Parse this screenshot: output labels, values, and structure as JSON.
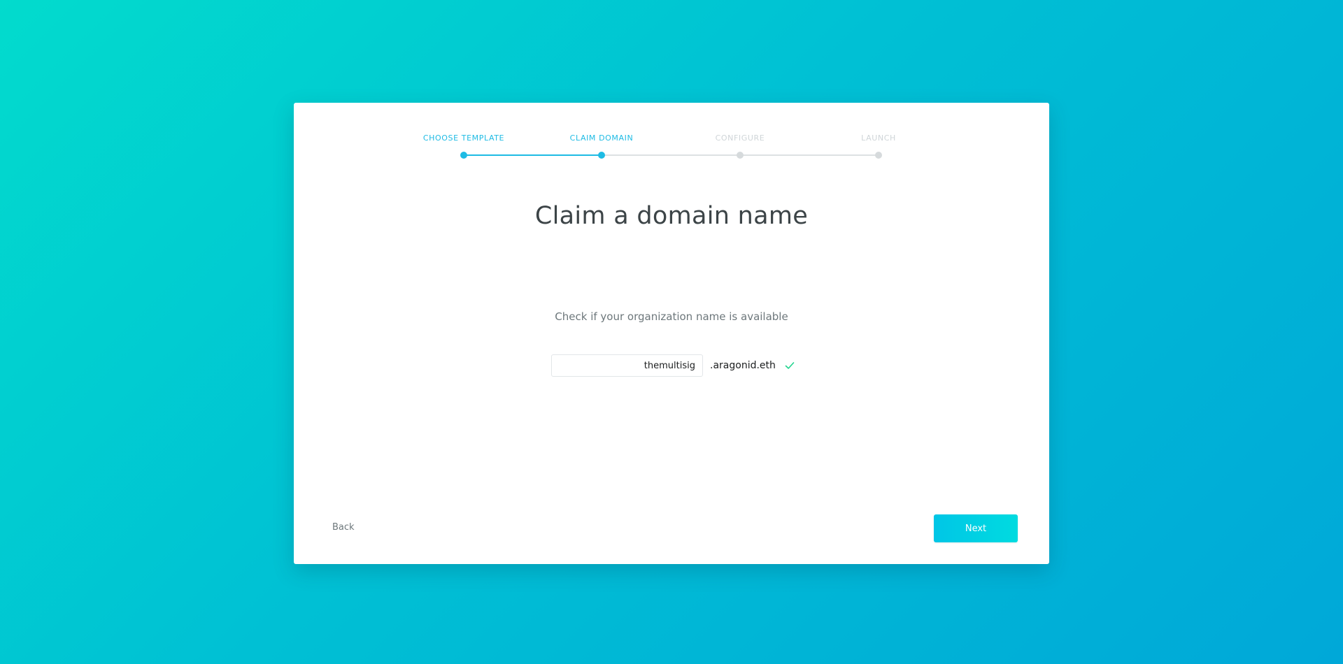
{
  "stepper": {
    "steps": [
      {
        "label": "Choose template",
        "state": "done"
      },
      {
        "label": "Claim domain",
        "state": "active"
      },
      {
        "label": "Configure",
        "state": "pending"
      },
      {
        "label": "Launch",
        "state": "pending"
      }
    ]
  },
  "main": {
    "title": "Claim a domain name",
    "subtitle": "Check if your organization name is available",
    "domain_input_value": "themultisig",
    "domain_suffix": ".aragonid.eth",
    "availability_icon": "check-icon"
  },
  "footer": {
    "back_label": "Back",
    "next_label": "Next"
  },
  "colors": {
    "accent": "#1ebbe4",
    "success": "#21d48e",
    "inactive": "#d6dadc"
  }
}
